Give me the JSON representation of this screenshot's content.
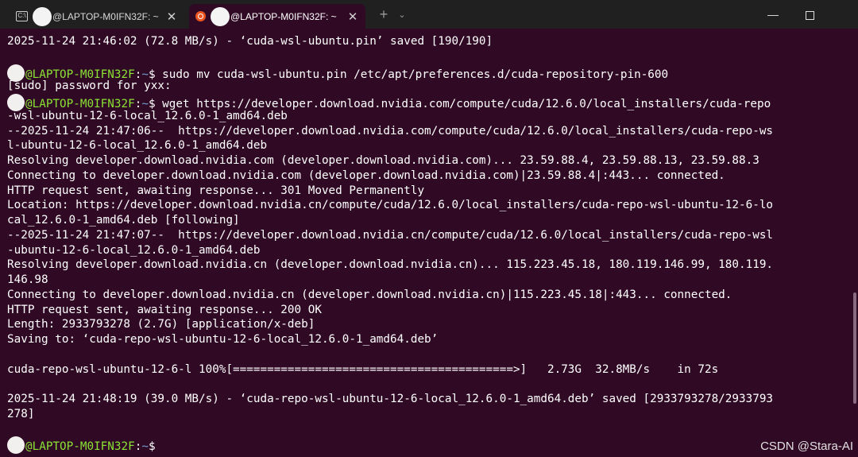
{
  "tabs": [
    {
      "title": "@LAPTOP-M0IFN32F: ~",
      "close": "✕",
      "icon": "cmd-icon"
    },
    {
      "title": "@LAPTOP-M0IFN32F: ~",
      "close": "✕",
      "icon": "ubuntu-icon"
    }
  ],
  "titlebar": {
    "new_tab": "+",
    "dropdown": "⌄",
    "minimize": "—"
  },
  "prompt": {
    "host": "@LAPTOP-M0IFN32F",
    "sep": ":",
    "path": "~",
    "dollar": "$ "
  },
  "lines": [
    {
      "text": "2025-11-24 21:46:02 (72.8 MB/s) - ‘cuda-wsl-ubuntu.pin’ saved [190/190]"
    },
    {
      "text": ""
    },
    {
      "prompt": true,
      "text": "sudo mv cuda-wsl-ubuntu.pin /etc/apt/preferences.d/cuda-repository-pin-600"
    },
    {
      "text": "[sudo] password for yxx:"
    },
    {
      "prompt": true,
      "text": "wget https://developer.download.nvidia.com/compute/cuda/12.6.0/local_installers/cuda-repo"
    },
    {
      "text": "-wsl-ubuntu-12-6-local_12.6.0-1_amd64.deb"
    },
    {
      "text": "--2025-11-24 21:47:06--  https://developer.download.nvidia.com/compute/cuda/12.6.0/local_installers/cuda-repo-ws"
    },
    {
      "text": "l-ubuntu-12-6-local_12.6.0-1_amd64.deb"
    },
    {
      "text": "Resolving developer.download.nvidia.com (developer.download.nvidia.com)... 23.59.88.4, 23.59.88.13, 23.59.88.3"
    },
    {
      "text": "Connecting to developer.download.nvidia.com (developer.download.nvidia.com)|23.59.88.4|:443... connected."
    },
    {
      "text": "HTTP request sent, awaiting response... 301 Moved Permanently"
    },
    {
      "text": "Location: https://developer.download.nvidia.cn/compute/cuda/12.6.0/local_installers/cuda-repo-wsl-ubuntu-12-6-lo"
    },
    {
      "text": "cal_12.6.0-1_amd64.deb [following]"
    },
    {
      "text": "--2025-11-24 21:47:07--  https://developer.download.nvidia.cn/compute/cuda/12.6.0/local_installers/cuda-repo-wsl"
    },
    {
      "text": "-ubuntu-12-6-local_12.6.0-1_amd64.deb"
    },
    {
      "text": "Resolving developer.download.nvidia.cn (developer.download.nvidia.cn)... 115.223.45.18, 180.119.146.99, 180.119."
    },
    {
      "text": "146.98"
    },
    {
      "text": "Connecting to developer.download.nvidia.cn (developer.download.nvidia.cn)|115.223.45.18|:443... connected."
    },
    {
      "text": "HTTP request sent, awaiting response... 200 OK"
    },
    {
      "text": "Length: 2933793278 (2.7G) [application/x-deb]"
    },
    {
      "text": "Saving to: ‘cuda-repo-wsl-ubuntu-12-6-local_12.6.0-1_amd64.deb’"
    },
    {
      "text": ""
    },
    {
      "text": "cuda-repo-wsl-ubuntu-12-6-l 100%[=========================================>]   2.73G  32.8MB/s    in 72s"
    },
    {
      "text": ""
    },
    {
      "text": "2025-11-24 21:48:19 (39.0 MB/s) - ‘cuda-repo-wsl-ubuntu-12-6-local_12.6.0-1_amd64.deb’ saved [2933793278/2933793"
    },
    {
      "text": "278]"
    },
    {
      "text": ""
    },
    {
      "prompt": true,
      "text": ""
    }
  ],
  "watermark": "CSDN @Stara-AI",
  "colors": {
    "background": "#300a24",
    "prompt_user": "#8ae234",
    "prompt_path": "#729fcf",
    "titlebar": "#202020"
  }
}
